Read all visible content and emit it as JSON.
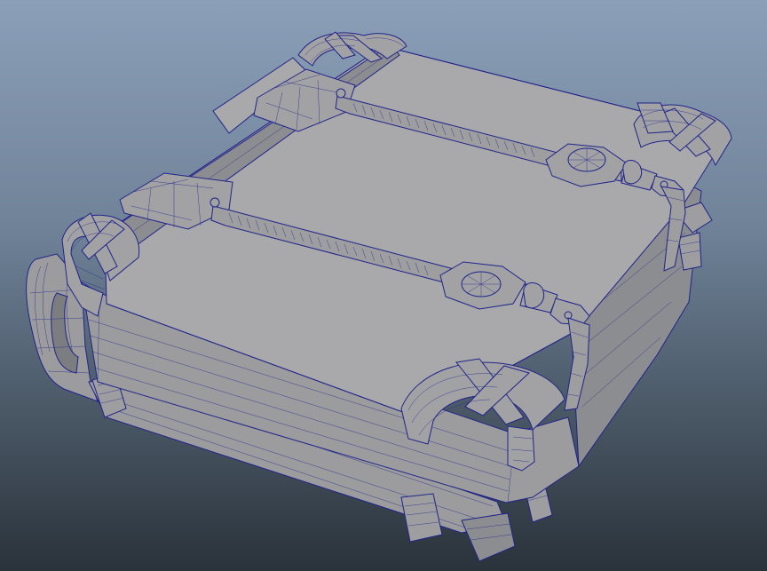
{
  "scene": {
    "subject": "book-model-wireframe",
    "colors": {
      "background_top": "#8b9fb8",
      "background_bottom": "#2a323a",
      "surface": "#a9a9ab",
      "wireframe": "#20238a"
    }
  }
}
